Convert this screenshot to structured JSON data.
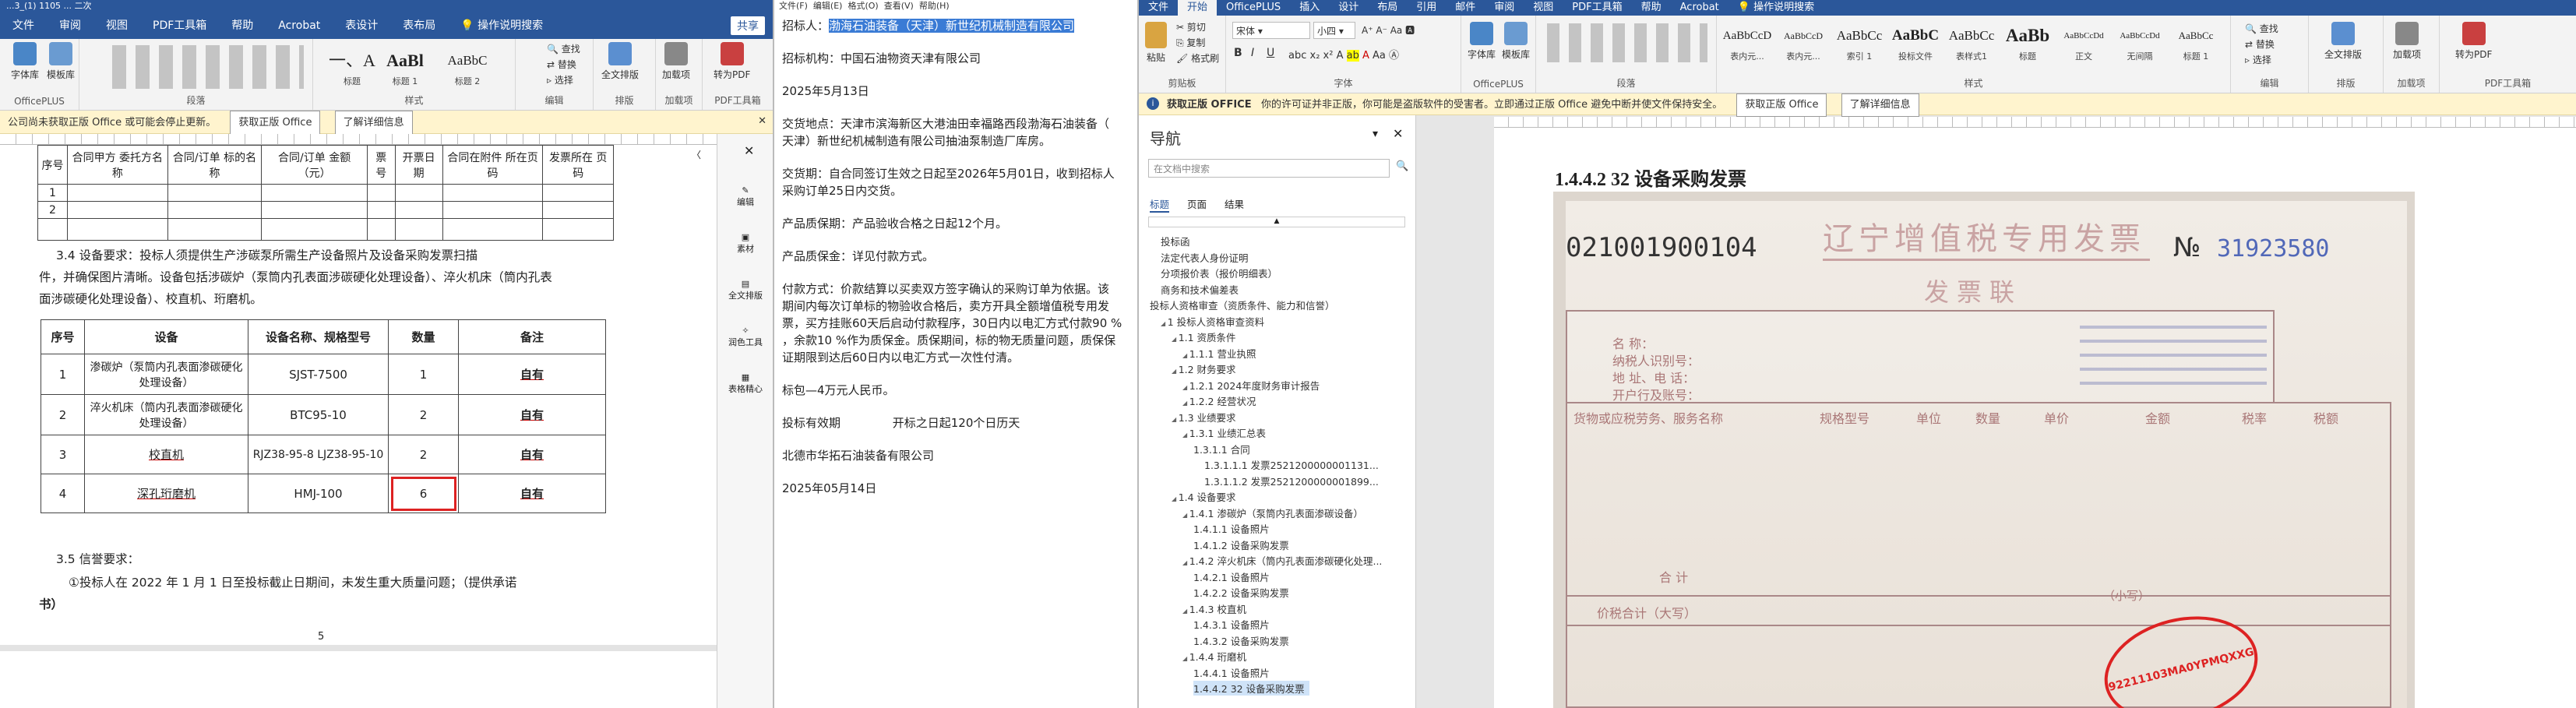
{
  "left_window": {
    "title": "...3_(1) 1105 ... 二次",
    "tabs": [
      "文件",
      "审阅",
      "视图",
      "PDF工具箱",
      "帮助",
      "Acrobat",
      "表设计",
      "表布局",
      "操作说明搜索"
    ],
    "share": "共享",
    "groups": [
      {
        "label": "OfficePLUS"
      },
      {
        "label": "字体"
      },
      {
        "label": "段落"
      },
      {
        "label": "样式"
      },
      {
        "label": "编辑"
      },
      {
        "label": "排版"
      },
      {
        "label": "加载项"
      },
      {
        "label": "PDF工具箱"
      }
    ],
    "buttons": {
      "font": "字体库",
      "template": "模板库",
      "find": "查找",
      "replace": "替换",
      "select": "选择",
      "layout": "全文排版",
      "addins": "加载项",
      "to_pdf": "转为PDF"
    },
    "styles": [
      {
        "big": "一、A",
        "name": "标题"
      },
      {
        "big": "AaBl",
        "name": "标题 1"
      },
      {
        "big": "AaBbC",
        "name": "标题 2"
      }
    ],
    "warning": {
      "text": "公司尚未获取正版 Office 或可能会停止更新。",
      "btn1": "获取正版 Office",
      "btn2": "了解详细信息"
    },
    "table1_headers": [
      "序号",
      "合同甲方 委托方名称",
      "合同/订单 标的名称",
      "合同/订单 金额（元）",
      "票号",
      "开票日期",
      "合同在附件 所在页码",
      "发票所在 页码"
    ],
    "para1": "3.4 设备要求：投标人须提供生产涉碳泵所需生产设备照片及设备采购发票扫描",
    "para2": "件，并确保图片清晰。设备包括涉碳炉（泵筒内孔表面涉碳硬化处理设备）、淬火机床（筒内孔表",
    "para3": "面涉碳硬化处理设备）、校直机、珩磨机。",
    "table2_headers": [
      "序号",
      "设备",
      "设备名称、规格型号",
      "数量",
      "备注"
    ],
    "table2_rows": [
      {
        "no": "1",
        "equip": "渗碳炉（泵筒内孔表面渗碳硬化处理设备）",
        "model": "SJST-7500",
        "qty": "1",
        "note": "自有"
      },
      {
        "no": "2",
        "equip": "淬火机床（筒内孔表面渗碳硬化处理设备）",
        "model": "BTC95-10",
        "qty": "2",
        "note": "自有"
      },
      {
        "no": "3",
        "equip": "校直机",
        "model": "RJZ38-95-8 LJZ38-95-10",
        "qty": "2",
        "note": "自有"
      },
      {
        "no": "4",
        "equip": "深孔珩磨机",
        "model": "HMJ-100",
        "qty": "6",
        "note": "自有"
      }
    ],
    "para4": "3.5 信誉要求：",
    "para5": "①投标人在 2022 年 1 月 1 日至投标截止日期间，未发生重大质量问题；（提供承诺",
    "para6": "书）",
    "page_num": "5",
    "side_tools": [
      "编辑",
      "素材",
      "全文排版",
      "润色工具",
      "表格精心"
    ]
  },
  "notepad": {
    "menu": [
      "文件(F)",
      "编辑(E)",
      "格式(O)",
      "查看(V)",
      "帮助(H)"
    ],
    "lines": [
      {
        "text": "招标人：",
        "sel": "渤海石油装备（天津）新世纪机械制造有限公司"
      },
      {
        "text": "招标机构：中国石油物资天津有限公司"
      },
      {
        "text": "2025年5月13日"
      },
      {
        "text": "交货地点：天津市滨海新区大港油田幸福路西段渤海石油装备（"
      },
      {
        "text": "天津）新世纪机械制造有限公司抽油泵制造厂库房。"
      },
      {
        "text": "交货期：自合同签订生效之日起至2026年5月01日，收到招标人"
      },
      {
        "text": "采购订单25日内交货。"
      },
      {
        "text": "产品质保期：产品验收合格之日起12个月。"
      },
      {
        "text": "产品质保金：详见付款方式。"
      },
      {
        "text": "付款方式：价款结算以买卖双方签字确认的采购订单为依据。该"
      },
      {
        "text": "期间内每次订单标的物验收合格后，卖方开具全额增值税专用发"
      },
      {
        "text": "票，买方挂账60天后启动付款程序，30日内以电汇方式付款90 %"
      },
      {
        "text": "，余款10 %作为质保金。质保期间，标的物无质量问题，质保保"
      },
      {
        "text": "证期限到达后60日内以电汇方式一次性付清。"
      },
      {
        "text": "标包—4万元人民币。"
      },
      {
        "text": "投标有效期              开标之日起120个日历天"
      },
      {
        "text": "北德市华拓石油装备有限公司"
      },
      {
        "text": "2025年05月14日"
      }
    ]
  },
  "right_window": {
    "tabs": [
      "文件",
      "开始",
      "OfficePLUS",
      "插入",
      "设计",
      "布局",
      "引用",
      "邮件",
      "审阅",
      "视图",
      "PDF工具箱",
      "帮助",
      "Acrobat",
      "操作说明搜索"
    ],
    "font_name": "宋体",
    "font_size": "小四",
    "groups": [
      {
        "label": "剪贴板"
      },
      {
        "label": "字体"
      },
      {
        "label": "OfficePLUS"
      },
      {
        "label": "段落"
      },
      {
        "label": "样式"
      },
      {
        "label": "编辑"
      },
      {
        "label": "排版"
      },
      {
        "label": "加载项"
      },
      {
        "label": "PDF工具箱"
      }
    ],
    "buttons": {
      "paste": "粘贴",
      "cut": "剪切",
      "copy": "复制",
      "painter": "格式刷",
      "font": "字体库",
      "template": "模板库",
      "find": "查找",
      "replace": "替换",
      "select": "选择",
      "layout": "全文排版",
      "addins": "加载项",
      "to_pdf": "转为PDF"
    },
    "styles": [
      {
        "big": "AaBbCcD",
        "name": "表内元..."
      },
      {
        "big": "AaBbCcD",
        "name": "表内元..."
      },
      {
        "big": "AaBbCc",
        "name": "索引 1"
      },
      {
        "big": "AaBbC",
        "name": "投标文件"
      },
      {
        "big": "AaBbCc",
        "name": "表样式1"
      },
      {
        "big": "AaBb",
        "name": "标题"
      },
      {
        "big": "AaBbCcDd",
        "name": "正文"
      },
      {
        "big": "AaBbCcDd",
        "name": "无间隔"
      },
      {
        "big": "AaBbCc",
        "name": "标题 1"
      }
    ],
    "warning": {
      "label": "获取正版 OFFICE",
      "text": "你的许可证并非正版，你可能是盗版软件的受害者。立即通过正版 Office 避免中断并使文件保持安全。",
      "btn1": "获取正版 Office",
      "btn2": "了解详细信息"
    },
    "nav": {
      "title": "导航",
      "search_placeholder": "在文档中搜索",
      "tabs": [
        "标题",
        "页面",
        "结果"
      ],
      "items": [
        {
          "text": "投标函",
          "level": 1
        },
        {
          "text": "法定代表人身份证明",
          "level": 1
        },
        {
          "text": "分项报价表（报价明细表）",
          "level": 1
        },
        {
          "text": "商务和技术偏差表",
          "level": 1
        },
        {
          "text": "投标人资格审查（资质条件、能力和信誉）",
          "level": 0
        },
        {
          "text": "1 投标人资格审查资料",
          "level": 1
        },
        {
          "text": "1.1 资质条件",
          "level": 2
        },
        {
          "text": "1.1.1 营业执照",
          "level": 3
        },
        {
          "text": "1.2 财务要求",
          "level": 2
        },
        {
          "text": "1.2.1 2024年度财务审计报告",
          "level": 3
        },
        {
          "text": "1.2.2 经营状况",
          "level": 3
        },
        {
          "text": "1.3 业绩要求",
          "level": 2
        },
        {
          "text": "1.3.1 业绩汇总表",
          "level": 3
        },
        {
          "text": "1.3.1.1 合同",
          "level": 4
        },
        {
          "text": "1.3.1.1.1 发票2521200000001131...",
          "level": 5
        },
        {
          "text": "1.3.1.1.2 发票2521200000001899...",
          "level": 5
        },
        {
          "text": "1.4 设备要求",
          "level": 2
        },
        {
          "text": "1.4.1 渗碳炉（泵筒内孔表面渗碳设备）",
          "level": 3
        },
        {
          "text": "1.4.1.1 设备照片",
          "level": 4
        },
        {
          "text": "1.4.1.2 设备采购发票",
          "level": 4
        },
        {
          "text": "1.4.2 淬火机床（筒内孔表面渗碳硬化处理...",
          "level": 3
        },
        {
          "text": "1.4.2.1 设备照片",
          "level": 4
        },
        {
          "text": "1.4.2.2 设备采购发票",
          "level": 4
        },
        {
          "text": "1.4.3 校直机",
          "level": 3
        },
        {
          "text": "1.4.3.1 设备照片",
          "level": 4
        },
        {
          "text": "1.4.3.2 设备采购发票",
          "level": 4
        },
        {
          "text": "1.4.4 珩磨机",
          "level": 3
        },
        {
          "text": "1.4.4.1 设备照片",
          "level": 4
        },
        {
          "text": "1.4.4.2 32 设备采购发票",
          "level": 4,
          "selected": true
        }
      ]
    },
    "heading": "1.4.4.2  32 设备采购发票",
    "invoice": {
      "title": "辽宁增值税专用发票",
      "code": "021001900104",
      "no_label": "№",
      "no": "31923580",
      "lian": "发票联",
      "buyer_labels": [
        "名    称：",
        "纳税人识别号：",
        "地 址、电 话：",
        "开户行及账号："
      ],
      "item_header": [
        "货物或应税劳务、服务名称",
        "规格型号",
        "单位",
        "数量",
        "单价",
        "金额",
        "税率",
        "税额"
      ],
      "total_label": "合    计",
      "tax_total_label": "价税合计（大写）",
      "small_label": "（小写）",
      "stamp_text": "92211103MA0YPMQXXG"
    }
  }
}
